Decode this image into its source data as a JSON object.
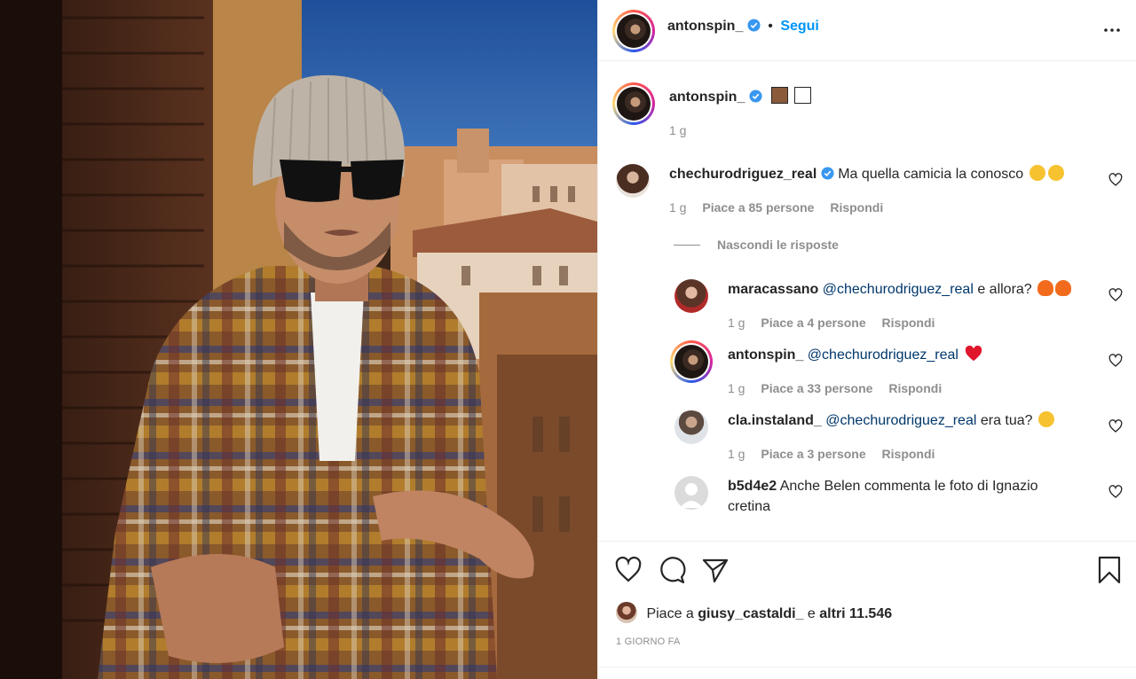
{
  "post": {
    "author": "antonspin_",
    "follow_label": "Segui",
    "separator": "•",
    "caption_time": "1 g",
    "caption_squares": [
      "brown-square",
      "white-square"
    ]
  },
  "comments": [
    {
      "user": "chechurodriguez_real",
      "verified": true,
      "text": "Ma quella camicia la conosco",
      "emojis": [
        "laughing-tears",
        "surprised-face"
      ],
      "time": "1 g",
      "likes": "Piace a 85 persone",
      "reply": "Rispondi",
      "toggle_replies": "Nascondi le risposte",
      "replies": [
        {
          "user": "maracassano",
          "mention": "@chechurodriguez_real",
          "text": "e allora?",
          "emojis": [
            "fire",
            "fire"
          ],
          "time": "1 g",
          "likes": "Piace a 4 persone",
          "reply": "Rispondi"
        },
        {
          "user": "antonspin_",
          "mention": "@chechurodriguez_real",
          "text": "",
          "emojis": [
            "red-heart"
          ],
          "time": "1 g",
          "likes": "Piace a 33 persone",
          "reply": "Rispondi"
        },
        {
          "user": "cla.instaland_",
          "mention": "@chechurodriguez_real",
          "text": "era tua?",
          "emojis": [
            "laughing-tears"
          ],
          "time": "1 g",
          "likes": "Piace a 3 persone",
          "reply": "Rispondi"
        },
        {
          "user": "b5d4e2",
          "mention": "",
          "text_line1": "Anche Belen commenta le foto di Ignazio",
          "text_line2": "cretina"
        }
      ]
    }
  ],
  "footer": {
    "likes_prefix": "Piace a",
    "likes_user": "giusy_castaldi_",
    "likes_mid": "e",
    "likes_rest": "altri 11.546",
    "date": "1 GIORNO FA"
  },
  "colors": {
    "link_blue": "#0095f6",
    "mention_blue": "#00376b",
    "meta_gray": "#8e8e8e",
    "verified_blue": "#3897f0"
  },
  "icons": [
    "heart-icon",
    "comment-icon",
    "share-icon",
    "bookmark-icon",
    "more-options-icon",
    "verified-icon"
  ]
}
